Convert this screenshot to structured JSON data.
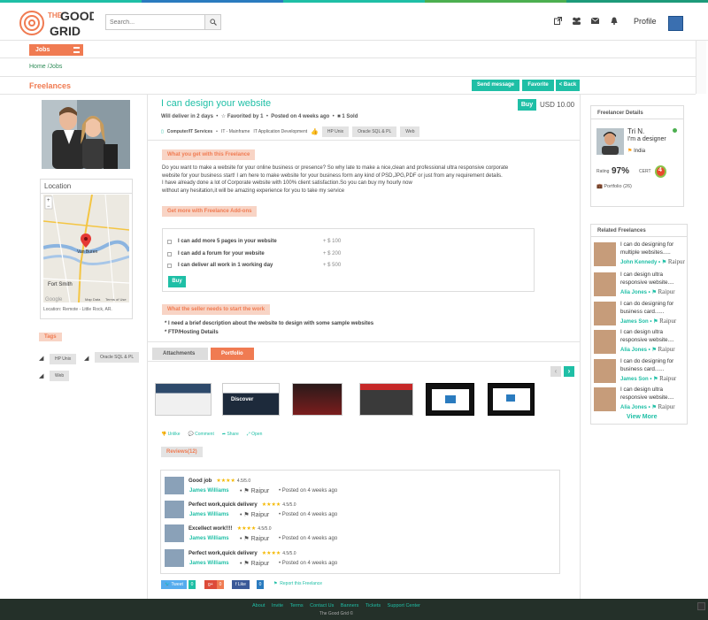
{
  "header": {
    "logo_text_1": "THE",
    "logo_text_2": "GOOD",
    "logo_text_3": "GRID",
    "search_placeholder": "Search...",
    "profile_label": "Profile",
    "icons": [
      "external-link-icon",
      "users-icon",
      "envelope-icon",
      "bell-icon"
    ]
  },
  "nav": {
    "jobs_label": "Jobs"
  },
  "breadcrumb": "Home /Jobs",
  "page_title": "Freelances",
  "toolbar": {
    "send_message": "Send message",
    "favorite": "Favorite",
    "back": "< Back"
  },
  "gig": {
    "title": "I can design your website",
    "buy_label": "Buy",
    "price": "USD 10.00",
    "delivery": "Will deliver in 2 days",
    "favorited": "Favorited by 1",
    "posted": "Posted on 4 weeks ago",
    "sold": "1 Sold",
    "category": "Computer/IT Services",
    "subcategory_1": "IT - Mainframe",
    "subcategory_2": "IT Application Development",
    "tags": [
      "HP Unix",
      "Oracle SQL & PL",
      "Web"
    ]
  },
  "sections": {
    "what_you_get": "What you get with this Freelance",
    "addons_title": "Get more with Freelance Add-ons",
    "needs_title": "What the seller needs to start the work"
  },
  "description": [
    "Do you want to make a website for your online business or presence? So why late to make a nice,clean and professional ultra responsive corporate",
    "website for your business start!   I am here to make website for your business form any kind of PSD,JPG,PDF or just from any requirement details.",
    "I have already done a lot of Corporate website with 100% client satisfaction.So you can buy my hourly now",
    "without any hesitation,it will be amazing experience for you to take my service"
  ],
  "addons": [
    {
      "label": "I can add more 5 pages in your website",
      "price": "+ $  100"
    },
    {
      "label": "I can add a forum for your website",
      "price": "+ $  200"
    },
    {
      "label": "I can deliver all work in 1 working day",
      "price": "+ $  500"
    }
  ],
  "addons_buy": "Buy",
  "requirements": [
    "* I need a brief description about the website to design with some sample websites",
    "* FTP/Hosting Details"
  ],
  "tabs": {
    "attachments": "Attachments",
    "portfolio": "Portfolio"
  },
  "portfolio_thumbs": [
    {
      "caption": ""
    },
    {
      "caption": "Discover"
    },
    {
      "caption": ""
    },
    {
      "caption": ""
    },
    {
      "caption": ""
    },
    {
      "caption": ""
    }
  ],
  "actions": {
    "unlike": "Unlike",
    "comment": "Comment",
    "share": "Share",
    "open": "Open"
  },
  "reviews_title": "Reviews(12)",
  "reviews": [
    {
      "title": "Good job",
      "stars": "★★★★",
      "score": "4.5/5.0",
      "name": "James Williams",
      "location": "Raipur",
      "posted": "Posted on 4 weeks ago"
    },
    {
      "title": "Perfect work,quick delivery",
      "stars": "★★★★",
      "score": "4.5/5.0",
      "name": "James Williams",
      "location": "Raipur",
      "posted": "Posted on 4 weeks ago"
    },
    {
      "title": "Excellect work!!!!",
      "stars": "★★★★",
      "score": "4.5/5.0",
      "name": "James Williams",
      "location": "Raipur",
      "posted": "Posted on 4 weeks ago"
    },
    {
      "title": "Perfect work,quick delivery",
      "stars": "★★★★",
      "score": "4.5/5.0",
      "name": "James Williams",
      "location": "Raipur",
      "posted": "Posted on 4 weeks ago"
    }
  ],
  "social": {
    "tweet": "Tweet",
    "tweet_count": "0",
    "gplus": "g+",
    "gplus_count": "0",
    "like": "Like",
    "like_count": "0",
    "report": "Report this Freelance"
  },
  "location": {
    "title": "Location",
    "text": "Location: Remote - Little Rock, AR.",
    "map_city_1": "Van Buren",
    "map_city_2": "Fort Smith",
    "map_google": "Google",
    "map_data": "Map Data",
    "map_terms": "Terms of Use"
  },
  "tags_title": "Tags",
  "freelancer": {
    "title": "Freelancer Details",
    "name": "Tri N.",
    "role": "I'm a designer",
    "country": "India",
    "rating_label": "Rating",
    "rating_value": "97%",
    "cert_label": "CERT",
    "cert_value": "4",
    "portfolio": "Portfolio (26)"
  },
  "related": {
    "title": "Related Freelances",
    "items": [
      {
        "title": "I can do designing for multiple websites.....",
        "name": "John Kennedy",
        "location": "Raipur"
      },
      {
        "title": "I can design ultra responsive website....",
        "name": "Alia Jones",
        "location": "Raipur"
      },
      {
        "title": "I can do designing for business card......",
        "name": "James Son",
        "location": "Raipur"
      },
      {
        "title": "I can design ultra responsive website....",
        "name": "Alia Jones",
        "location": "Raipur"
      },
      {
        "title": "I can do designing for business card......",
        "name": "James Son",
        "location": "Raipur"
      },
      {
        "title": "I can design ultra responsive website....",
        "name": "Alia Jones",
        "location": "Raipur"
      }
    ],
    "view_more": "View More"
  },
  "footer": {
    "links": [
      "About",
      "Invite",
      "Terms",
      "Contact Us",
      "Banners",
      "Tickets",
      "Support Center"
    ],
    "copyright": "The Good Grid ©"
  },
  "colors": {
    "accent": "#1fbfa6",
    "orange": "#f07b52",
    "footer": "#243029"
  }
}
